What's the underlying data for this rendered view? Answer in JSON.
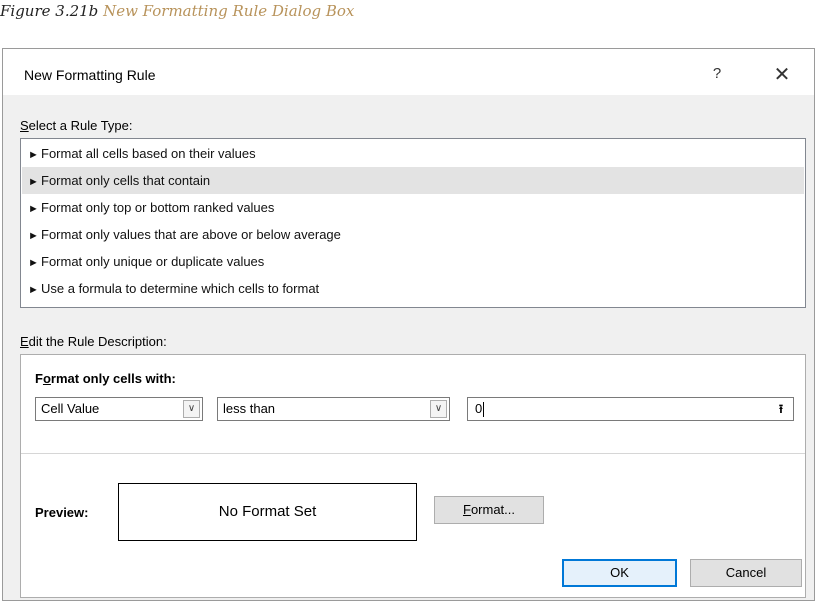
{
  "caption": {
    "prefix": "Figure 3.21b ",
    "title": "New Formatting Rule Dialog Box"
  },
  "dialog": {
    "title": "New Formatting Rule",
    "help_glyph": "?",
    "close_glyph": "✕"
  },
  "rule_type": {
    "label_accel": "S",
    "label_rest": "elect a Rule Type:",
    "arrow_glyph": "►",
    "items": [
      "Format all cells based on their values",
      "Format only cells that contain",
      "Format only top or bottom ranked values",
      "Format only values that are above or below average",
      "Format only unique or duplicate values",
      "Use a formula to determine which cells to format"
    ],
    "selected_index": 1
  },
  "description": {
    "label_accel": "E",
    "label_rest": "dit the Rule Description:",
    "format_only_accel_pre": "F",
    "format_only_accel": "o",
    "format_only_rest": "rmat only cells with:",
    "condition_type": "Cell Value",
    "operator": "less than",
    "value": "0",
    "dropdown_glyph": "∨",
    "collapse_glyph": "⭱"
  },
  "preview": {
    "label": "Preview:",
    "text": "No Format Set",
    "format_button_accel": "F",
    "format_button_rest": "ormat..."
  },
  "buttons": {
    "ok": "OK",
    "cancel": "Cancel"
  },
  "colors": {
    "caption_link": "#b8935b",
    "ok_border": "#0078d7",
    "selection": "#e3e3e3"
  }
}
